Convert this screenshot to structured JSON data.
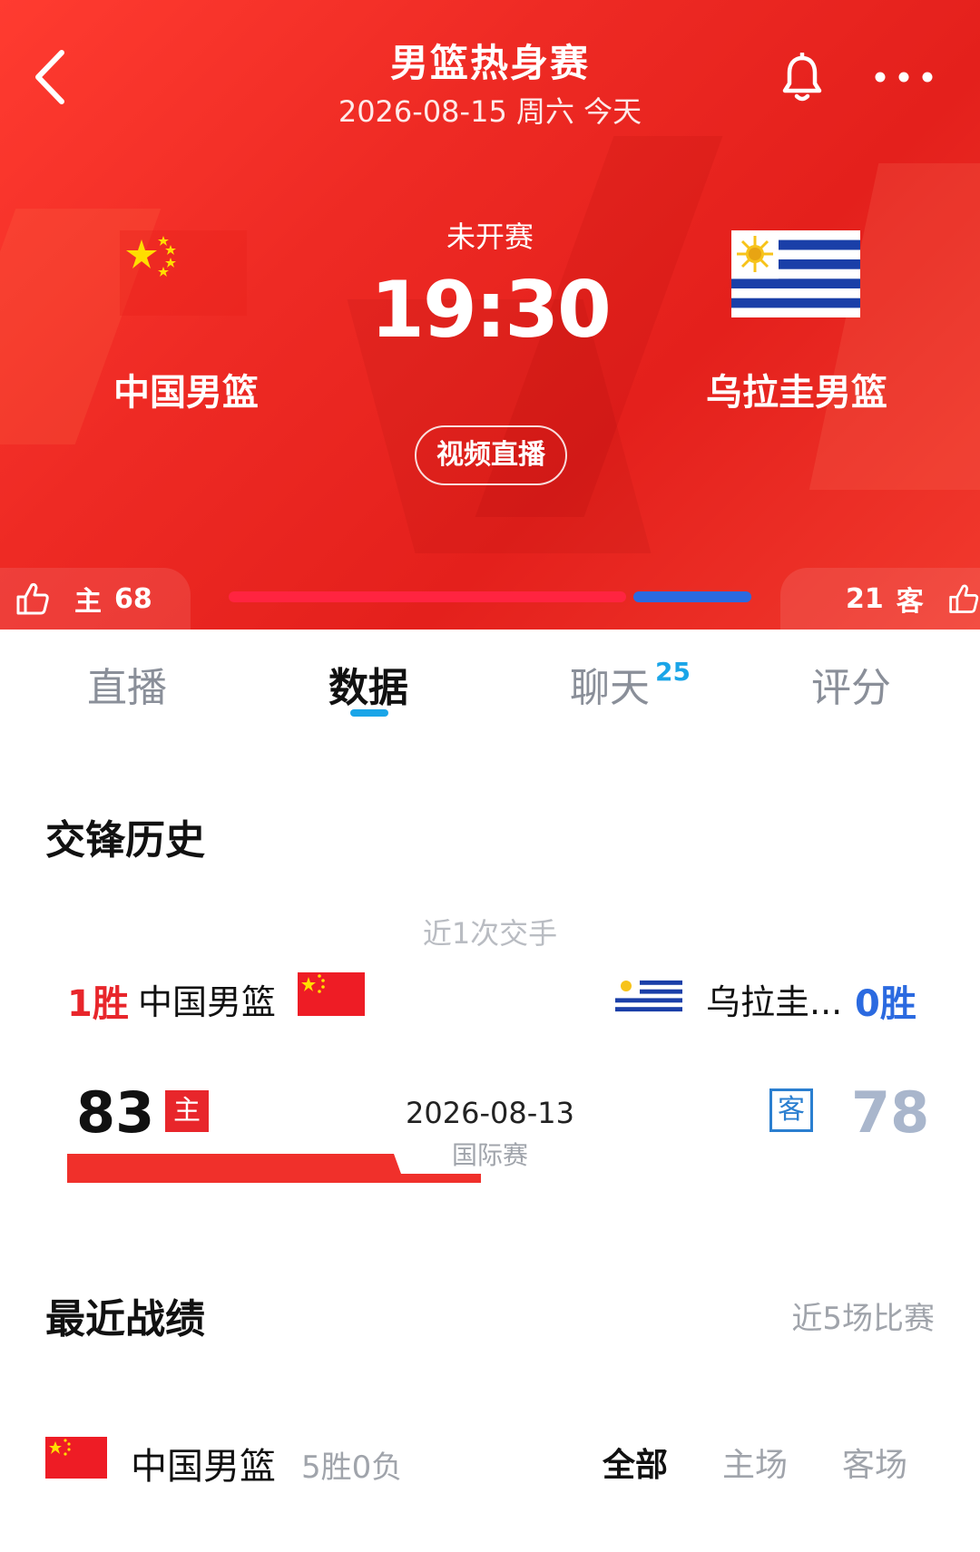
{
  "header": {
    "title": "男篮热身赛",
    "subtitle": "2026-08-15 周六 今天",
    "icons": {
      "back": "chevron-left-icon",
      "bell": "bell-icon",
      "more": "more-dots-icon"
    }
  },
  "match": {
    "home_team": "中国男篮",
    "away_team": "乌拉圭男篮",
    "status": "未开赛",
    "time": "19:30",
    "live_button": "视频直播"
  },
  "vote": {
    "home_label": "主",
    "home_count": "68",
    "away_label": "客",
    "away_count": "21",
    "home_share": 0.76,
    "away_share": 0.24,
    "home_color": "#ff2440",
    "away_color": "#2b6ae0"
  },
  "tabs": [
    {
      "label": "直播"
    },
    {
      "label": "数据"
    },
    {
      "label": "聊天",
      "badge": "25"
    },
    {
      "label": "评分"
    }
  ],
  "active_tab": "数据",
  "head_to_head": {
    "title": "交锋历史",
    "caption": "近1次交手",
    "home_wins": "1胜",
    "home_team": "中国男篮",
    "away_team": "乌拉圭...",
    "away_wins": "0胜",
    "match": {
      "home_score": "83",
      "home_badge": "主",
      "date": "2026-08-13",
      "type": "国际赛",
      "away_badge": "客",
      "away_score": "78"
    }
  },
  "recent_form": {
    "title": "最近战绩",
    "caption": "近5场比赛",
    "team": "中国男篮",
    "record": "5胜0负",
    "filters": [
      "全部",
      "主场",
      "客场"
    ],
    "active_filter": "全部"
  },
  "colors": {
    "header_red": "#ee2a24",
    "home_red": "#e8262b",
    "away_blue": "#2b6ae0",
    "tab_accent": "#1aa5e8"
  }
}
